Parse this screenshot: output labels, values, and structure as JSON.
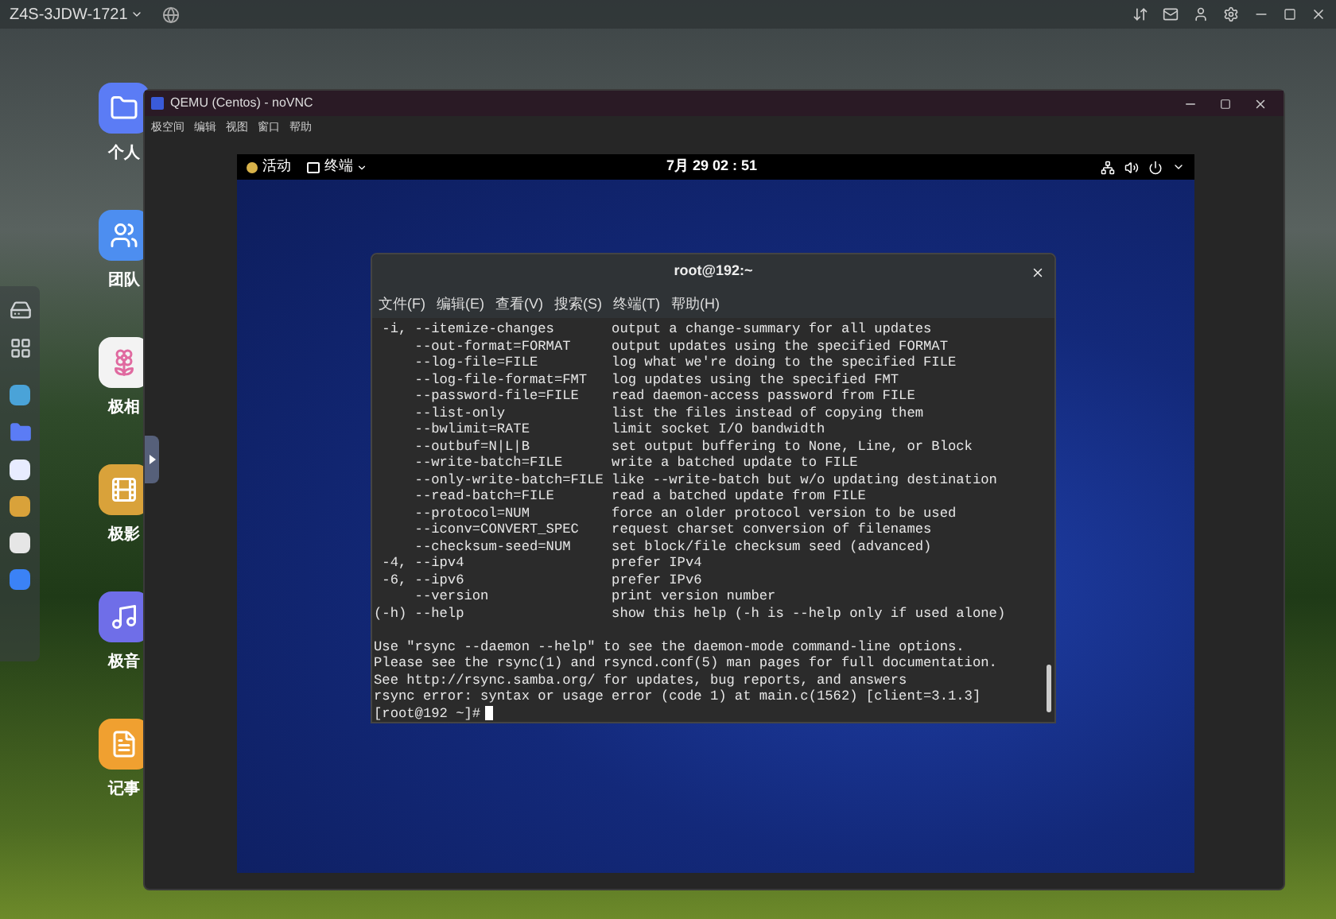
{
  "top_bar": {
    "device": "Z4S-3JDW-1721"
  },
  "desktop_icons": [
    {
      "label": "个人",
      "kind": "folder"
    },
    {
      "label": "团队",
      "kind": "team"
    },
    {
      "label": "极相",
      "kind": "photos"
    },
    {
      "label": "极影",
      "kind": "video"
    },
    {
      "label": "极音",
      "kind": "music"
    },
    {
      "label": "记事",
      "kind": "notes"
    }
  ],
  "qemu_window": {
    "title": "QEMU (Centos) - noVNC",
    "menu": [
      "极空间",
      "编辑",
      "视图",
      "窗口",
      "帮助"
    ]
  },
  "gnome_bar": {
    "activities": "活动",
    "app": "终端",
    "clock": "7月 29 02 : 51"
  },
  "terminal": {
    "title": "root@192:~",
    "menu": [
      "文件(F)",
      "编辑(E)",
      "查看(V)",
      "搜索(S)",
      "终端(T)",
      "帮助(H)"
    ],
    "lines": [
      " -i, --itemize-changes       output a change-summary for all updates",
      "     --out-format=FORMAT     output updates using the specified FORMAT",
      "     --log-file=FILE         log what we're doing to the specified FILE",
      "     --log-file-format=FMT   log updates using the specified FMT",
      "     --password-file=FILE    read daemon-access password from FILE",
      "     --list-only             list the files instead of copying them",
      "     --bwlimit=RATE          limit socket I/O bandwidth",
      "     --outbuf=N|L|B          set output buffering to None, Line, or Block",
      "     --write-batch=FILE      write a batched update to FILE",
      "     --only-write-batch=FILE like --write-batch but w/o updating destination",
      "     --read-batch=FILE       read a batched update from FILE",
      "     --protocol=NUM          force an older protocol version to be used",
      "     --iconv=CONVERT_SPEC    request charset conversion of filenames",
      "     --checksum-seed=NUM     set block/file checksum seed (advanced)",
      " -4, --ipv4                  prefer IPv4",
      " -6, --ipv6                  prefer IPv6",
      "     --version               print version number",
      "(-h) --help                  show this help (-h is --help only if used alone)",
      "Use \"rsync --daemon --help\" to see the daemon-mode command-line options.",
      "Please see the rsync(1) and rsyncd.conf(5) man pages for full documentation.",
      "See http://rsync.samba.org/ for updates, bug reports, and answers",
      "rsync error: syntax or usage error (code 1) at main.c(1562) [client=3.1.3]"
    ],
    "prompt": "[root@192 ~]#"
  }
}
